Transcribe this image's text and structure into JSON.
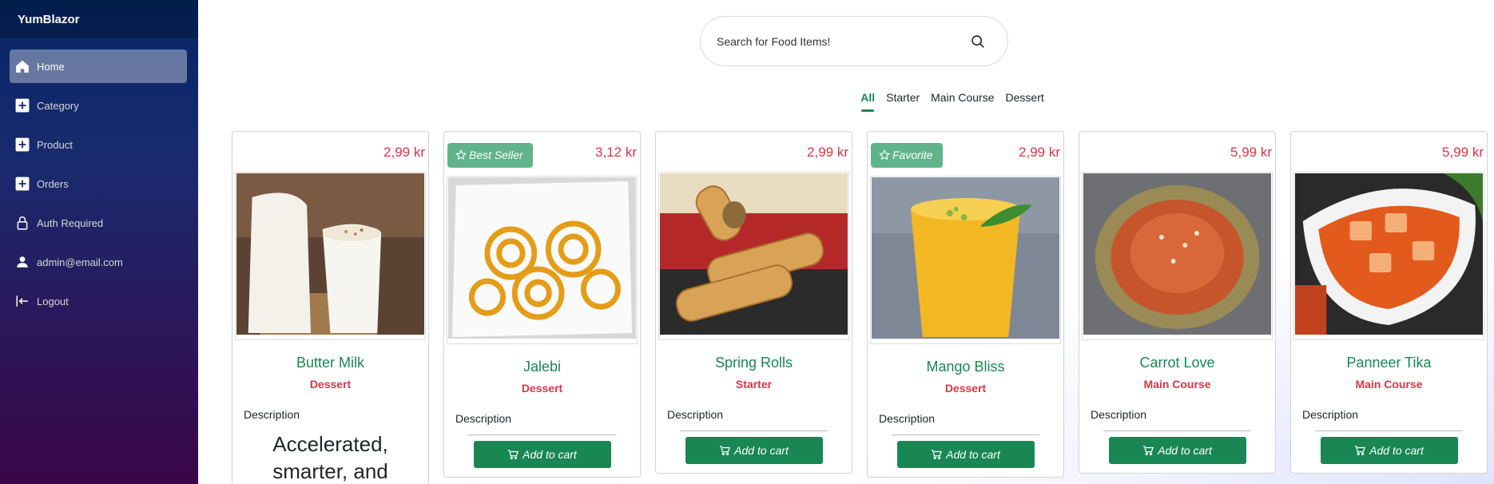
{
  "brand": "YumBlazor",
  "nav": [
    {
      "label": "Home",
      "icon": "home-icon",
      "active": true
    },
    {
      "label": "Category",
      "icon": "plus-square-icon"
    },
    {
      "label": "Product",
      "icon": "plus-square-icon"
    },
    {
      "label": "Orders",
      "icon": "plus-square-icon"
    },
    {
      "label": "Auth Required",
      "icon": "lock-icon"
    },
    {
      "label": "admin@email.com",
      "icon": "person-icon"
    },
    {
      "label": "Logout",
      "icon": "logout-icon"
    }
  ],
  "search": {
    "placeholder": "Search for Food Items!"
  },
  "tabs": [
    {
      "label": "All",
      "active": true
    },
    {
      "label": "Starter"
    },
    {
      "label": "Main Course"
    },
    {
      "label": "Dessert"
    }
  ],
  "product_labels": {
    "description": "Description",
    "add_to_cart": "Add to cart"
  },
  "products": [
    {
      "name": "Butter Milk",
      "price": "2,99 kr",
      "category": "Dessert",
      "badge": "",
      "extra_desc": "Accelerated, smarter, and"
    },
    {
      "name": "Jalebi",
      "price": "3,12 kr",
      "category": "Dessert",
      "badge": "Best Seller"
    },
    {
      "name": "Spring Rolls",
      "price": "2,99 kr",
      "category": "Starter",
      "badge": ""
    },
    {
      "name": "Mango Bliss",
      "price": "2,99 kr",
      "category": "Dessert",
      "badge": "Favorite"
    },
    {
      "name": "Carrot Love",
      "price": "5,99 kr",
      "category": "Main Course",
      "badge": ""
    },
    {
      "name": "Panneer Tika",
      "price": "5,99 kr",
      "category": "Main Course",
      "badge": ""
    }
  ]
}
